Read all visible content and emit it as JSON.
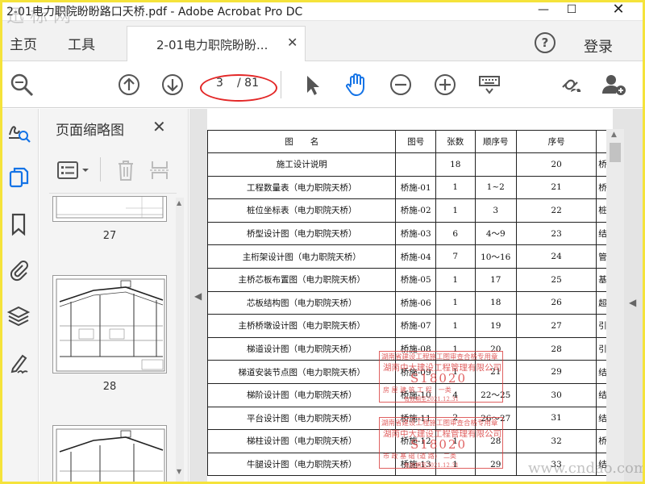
{
  "window": {
    "title": "2-01电力职院盼盼路口天桥.pdf - Adobe Acrobat Pro DC"
  },
  "tabs": {
    "home": "主页",
    "tools": "工具",
    "document": "2-01电力职院盼盼...",
    "login": "登录"
  },
  "toolbar": {
    "current_page": "3",
    "total_pages": "/ 81"
  },
  "panel": {
    "title": "页面缩略图",
    "thumbs": [
      {
        "page": "27"
      },
      {
        "page": "28"
      }
    ]
  },
  "table": {
    "headers": [
      "图　　名",
      "图号",
      "张数",
      "顺序号",
      "序号"
    ],
    "rows": [
      [
        "施工设计说明",
        "",
        "18",
        "",
        "20",
        "桥"
      ],
      [
        "工程数量表（电力职院天桥）",
        "桥施-01",
        "1",
        "1~2",
        "21",
        "桥"
      ],
      [
        "桩位坐标表（电力职院天桥）",
        "桥施-02",
        "1",
        "3",
        "22",
        "桩"
      ],
      [
        "桥型设计图（电力职院天桥）",
        "桥施-03",
        "6",
        "4～9",
        "23",
        "结"
      ],
      [
        "主桁架设计图（电力职院天桥）",
        "桥施-04",
        "7",
        "10～16",
        "24",
        "管"
      ],
      [
        "主桥芯板布置图（电力职院天桥）",
        "桥施-05",
        "1",
        "17",
        "25",
        "基"
      ],
      [
        "芯板结构图（电力职院天桥）",
        "桥施-06",
        "1",
        "18",
        "26",
        "超"
      ],
      [
        "主桥桥墩设计图（电力职院天桥）",
        "桥施-07",
        "1",
        "19",
        "27",
        "引"
      ],
      [
        "梯道设计图（电力职院天桥）",
        "桥施-08",
        "1",
        "20",
        "28",
        "引"
      ],
      [
        "梯道安装节点图（电力职院天桥）",
        "桥施-09",
        "1",
        "21",
        "29",
        "结"
      ],
      [
        "梯阶设计图（电力职院天桥）",
        "桥施-10",
        "4",
        "22～25",
        "30",
        "结"
      ],
      [
        "平台设计图（电力职院天桥）",
        "桥施-11",
        "2",
        "26～27",
        "31",
        "结"
      ],
      [
        "梯柱设计图（电力职院天桥）",
        "桥施-12",
        "1",
        "28",
        "32",
        "桥"
      ],
      [
        "牛腿设计图（电力职院天桥）",
        "桥施-13",
        "1",
        "29",
        "33",
        "结"
      ]
    ]
  },
  "stamps": [
    {
      "l1": "湖南省建设工程施工图审查合格专用章",
      "l2": "湖南中大建设工程管理有限公司",
      "l3": "S18020",
      "l4": "房 屋 建 筑 工 程　一类",
      "l5": "有效期至2021.12.31"
    },
    {
      "l1": "湖南省建设工程施工图审查合格专用章",
      "l2": "湖南中大建设工程管理有限公司",
      "l3": "S18020",
      "l4": "市 政 基 础 (道 路)　二类",
      "l5": "有效期至2021.12.31"
    }
  ],
  "watermarks": {
    "top": "迅 标 网",
    "bottom": "www.cndao.com"
  },
  "colors": {
    "annotation_red": "#e32727",
    "stamp_red": "#d93a3a",
    "acrobat_blue": "#1473e6",
    "frame_yellow": "#f5e33b"
  }
}
